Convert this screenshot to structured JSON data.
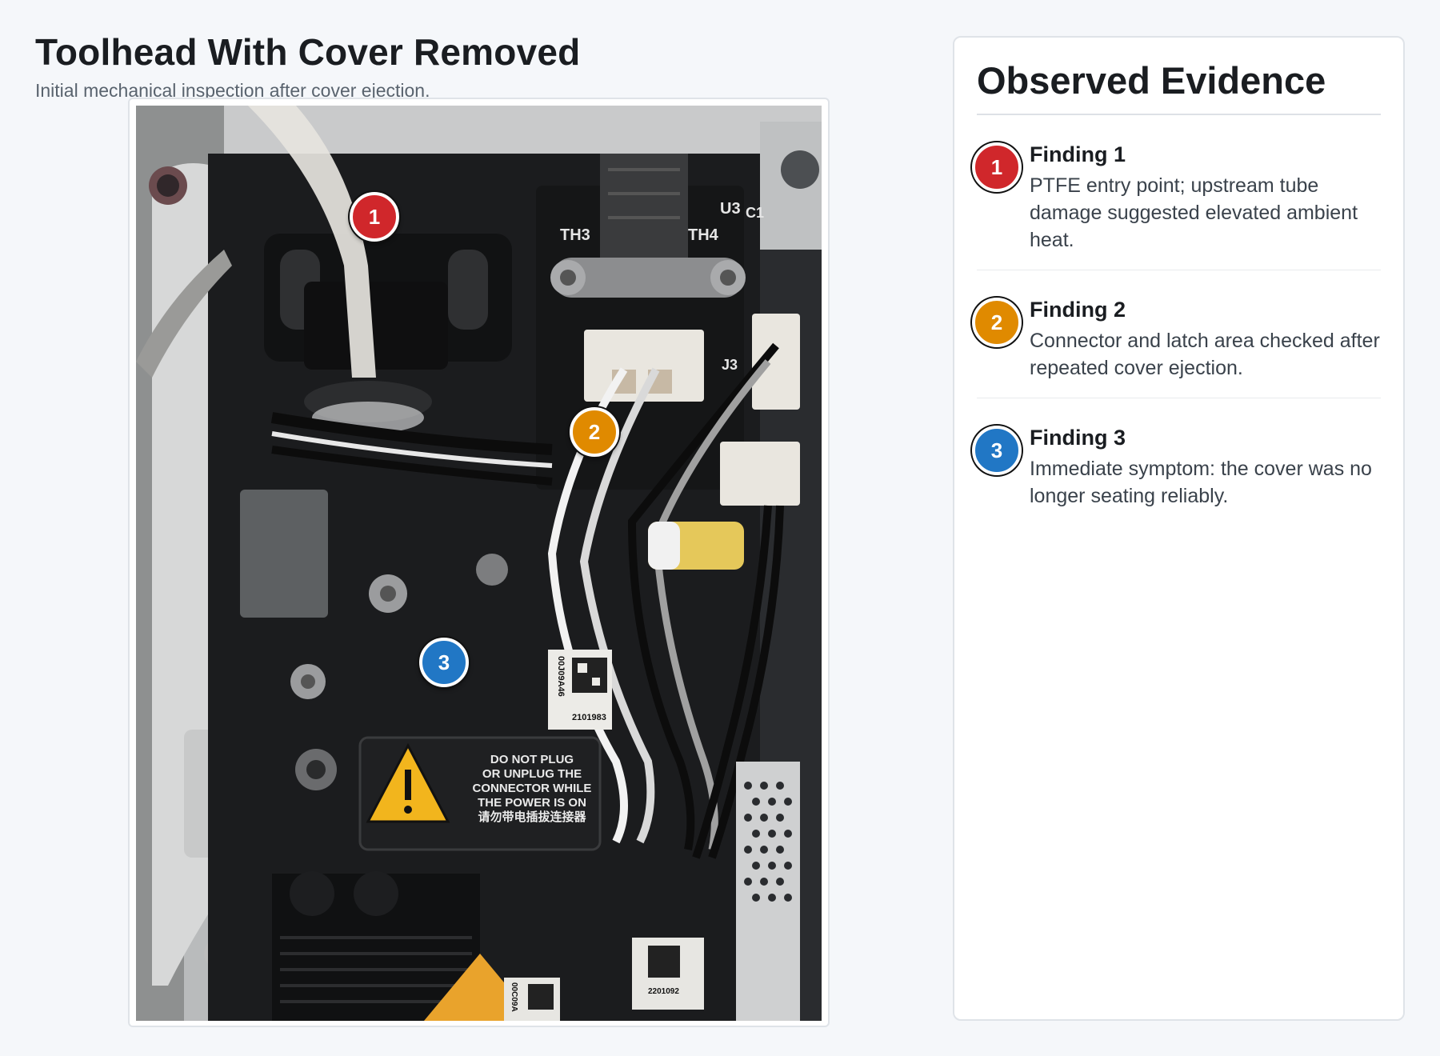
{
  "header": {
    "title": "Toolhead With Cover Removed",
    "subtitle": "Initial mechanical inspection after cover ejection."
  },
  "photo": {
    "label_lines": [
      "DO NOT PLUG",
      "OR UNPLUG THE",
      "CONNECTOR WHILE",
      "THE POWER IS ON",
      "请勿带电插拔连接器"
    ],
    "pcb_labels": [
      "TH3",
      "TH4",
      "U3",
      "C1",
      "J3"
    ],
    "qr_codes": [
      "00J09A46",
      "2101983"
    ],
    "qr_code_lower": "2201092",
    "qr_code_lower_left": "00C09A"
  },
  "markers": [
    {
      "number": "1",
      "color": "#d0272b"
    },
    {
      "number": "2",
      "color": "#e08a00"
    },
    {
      "number": "3",
      "color": "#2177c5"
    }
  ],
  "panel": {
    "title": "Observed Evidence",
    "findings": [
      {
        "number": "1",
        "title": "Finding 1",
        "text": "PTFE entry point; upstream tube damage suggested elevated ambient heat.",
        "color": "#d0272b"
      },
      {
        "number": "2",
        "title": "Finding 2",
        "text": "Connector and latch area checked after repeated cover ejection.",
        "color": "#e08a00"
      },
      {
        "number": "3",
        "title": "Finding 3",
        "text": "Immediate symptom: the cover was no longer seating reliably.",
        "color": "#2177c5"
      }
    ]
  }
}
